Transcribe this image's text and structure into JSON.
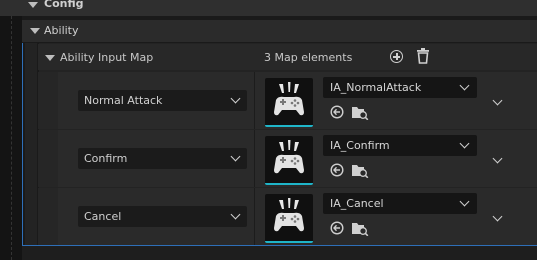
{
  "sections": {
    "config": "Config",
    "ability": "Ability",
    "ability_input_map": "Ability Input Map",
    "map_count": "3 Map elements"
  },
  "rows": [
    {
      "key": "Normal Attack",
      "asset": "IA_NormalAttack"
    },
    {
      "key": "Confirm",
      "asset": "IA_Confirm"
    },
    {
      "key": "Cancel",
      "asset": "IA_Cancel"
    }
  ],
  "icons": {
    "add": "add-element-icon",
    "delete": "delete-all-icon",
    "use": "use-selected-asset-icon",
    "browse": "browse-to-asset-icon",
    "thumbnail": "gamepad-thumbnail-icon"
  },
  "colors": {
    "selection_outline": "#2e6fb8",
    "thumbnail_underline": "#1fb5c9"
  }
}
